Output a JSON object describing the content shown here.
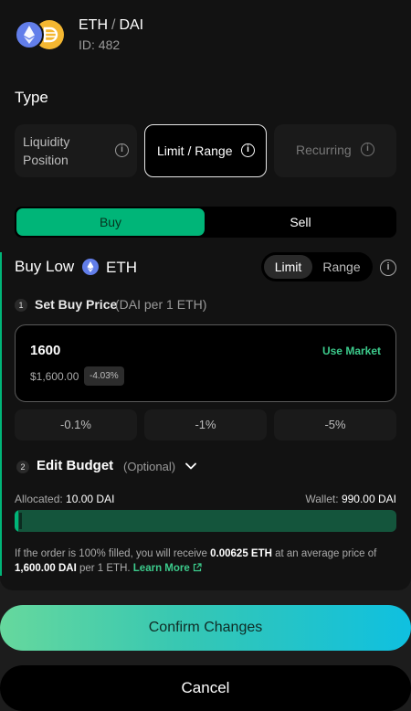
{
  "header": {
    "base_token": "ETH",
    "separator": "/",
    "quote_token": "DAI",
    "id_text": "ID: 482",
    "icons": [
      "eth-icon",
      "dai-icon"
    ]
  },
  "type": {
    "label": "Type",
    "options": [
      {
        "label": "Liquidity Position",
        "selected": false,
        "disabled": false
      },
      {
        "label": "Limit / Range",
        "selected": true,
        "disabled": false
      },
      {
        "label": "Recurring",
        "selected": false,
        "disabled": true
      }
    ],
    "info_icon": "info-icon"
  },
  "side": {
    "buy_label": "Buy",
    "sell_label": "Sell",
    "selected": "Buy"
  },
  "strategy": {
    "title": "Buy Low",
    "token": "ETH",
    "limit_label": "Limit",
    "range_label": "Range",
    "mode": "Limit"
  },
  "step1": {
    "number": "1",
    "label": "Set Buy Price",
    "sublabel": "(DAI per 1 ETH)",
    "price_value": "1600",
    "use_market": "Use Market",
    "usd_value": "$1,600.00",
    "diff_badge": "-4.03%",
    "presets": [
      "-0.1%",
      "-1%",
      "-5%"
    ]
  },
  "step2": {
    "number": "2",
    "label": "Edit Budget",
    "optional": "(Optional)",
    "allocated_label": "Allocated:",
    "allocated_value": "10.00 DAI",
    "wallet_label": "Wallet:",
    "wallet_value": "990.00 DAI",
    "allocated_fraction": 0.01
  },
  "note": {
    "prefix": "If the order is 100% filled, you will receive",
    "receive_amount": "0.00625 ETH",
    "middle": "at an average price of",
    "avg_price": "1,600.00 DAI",
    "suffix": "per 1 ETH.",
    "learn_more": "Learn More"
  },
  "actions": {
    "confirm_label": "Confirm Changes",
    "cancel_label": "Cancel"
  },
  "colors": {
    "accent_green": "#00b578",
    "link_green": "#3ccb8c",
    "eth_blue": "#627eea",
    "dai_yellow": "#f4b731"
  }
}
